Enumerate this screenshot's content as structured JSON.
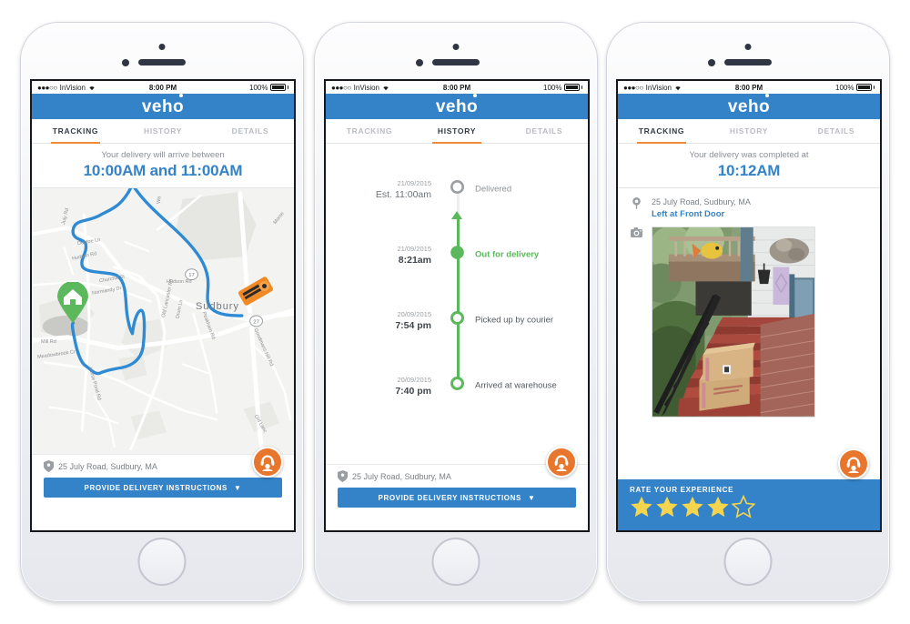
{
  "meta": {
    "app_name": "veho",
    "screens": 3
  },
  "status_bar": {
    "signal_dots": "●●●○○",
    "carrier": "InVision",
    "wifi_icon": "wifi-icon",
    "time": "8:00 PM",
    "battery_percent": "100%",
    "battery_icon": "battery-full-icon"
  },
  "brand": {
    "logo_text": "veho",
    "logo_color": "#ffffff",
    "header_color": "#3483c9"
  },
  "tabs": {
    "tracking": "TRACKING",
    "history": "HISTORY",
    "details": "DETAILS",
    "active_color": "#ef8b38",
    "inactive_color": "#b9bcc1"
  },
  "screen1": {
    "active_tab": "TRACKING",
    "eta": {
      "subtitle": "Your delivery will arrive between",
      "time_range": "10:00AM and 11:00AM",
      "color": "#3483c9"
    },
    "map": {
      "city_label": "Sudbury",
      "route_color": "#2f8ad4",
      "home_pin_color": "#5cb85c",
      "truck_color": "#f08a24",
      "street_labels": [
        "July Rd",
        "Dubtoe Ln",
        "Hudson Rd",
        "Churchill St",
        "Normandy Dr",
        "Old Lancaster Rd",
        "Drum Ln",
        "Hudson Rd",
        "Peakham Rd",
        "Mill Rd",
        "Meadowbrook Cr",
        "Horse Pond Rd",
        "Goodmans Hill Rd",
        "Old Lancaster Rd",
        "Morse",
        "Wa"
      ],
      "route_markers": [
        "17",
        "27"
      ]
    },
    "address": "25 July Road, Sudbury, MA",
    "cta_label": "PROVIDE DELIVERY INSTRUCTIONS",
    "cta_caret": "▼",
    "fab_icon": "support-headset-icon"
  },
  "screen2": {
    "active_tab": "HISTORY",
    "timeline": [
      {
        "date": "21/09/2015",
        "time": "Est. 11:00am",
        "label": "Delivered",
        "state": "pending",
        "dot": "hollow-grey"
      },
      {
        "date": "21/09/2015",
        "time": "8:21am",
        "label": "Out for delivery",
        "state": "current",
        "dot": "filled-green"
      },
      {
        "date": "20/09/2015",
        "time": "7:54 pm",
        "label": "Picked up by courier",
        "state": "complete",
        "dot": "hollow-green"
      },
      {
        "date": "20/09/2015",
        "time": "7:40 pm",
        "label": "Arrived at warehouse",
        "state": "complete",
        "dot": "hollow-green"
      }
    ],
    "green_color": "#5cb85c",
    "pending_color": "#9b9fa4",
    "address": "25 July Road, Sudbury, MA",
    "cta_label": "PROVIDE DELIVERY INSTRUCTIONS",
    "cta_caret": "▼",
    "fab_icon": "support-headset-icon"
  },
  "screen3": {
    "active_tab": "TRACKING",
    "eta": {
      "subtitle": "Your delivery was completed at",
      "time": "10:12AM",
      "color": "#3483c9"
    },
    "delivery": {
      "address": "25 July Road, Sudbury, MA",
      "drop_location": "Left at Front Door",
      "location_icon": "map-pin-icon",
      "photo_icon": "camera-icon",
      "photo_alt": "Two cardboard packages left on red front steps"
    },
    "rating": {
      "label": "RATE YOUR EXPERIENCE",
      "filled": 4,
      "total": 5,
      "star_color": "#f5d44e"
    },
    "fab_icon": "support-headset-icon"
  }
}
